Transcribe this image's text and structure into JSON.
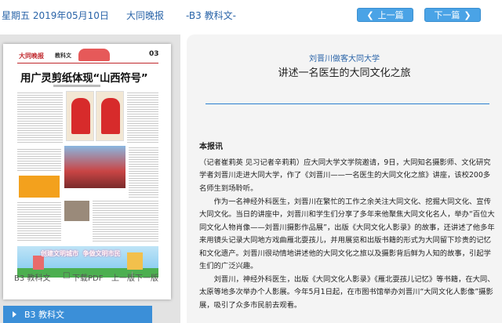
{
  "topbar": {
    "date": "星期五 2019年05月10日",
    "paper": "大同晚报",
    "page": "-B3 教科文-",
    "prev": "上一篇",
    "next": "下一篇"
  },
  "thumbnail": {
    "masthead": "大同晚报",
    "section": "教科文",
    "page_no": "03",
    "headline": "用广灵剪纸体现“山西符号”",
    "banner": "创建文明城市  争做文明市民"
  },
  "left": {
    "page_label": "B3 教科文",
    "download": "下载PDF",
    "prev_page": "上一版",
    "next_page": "下一版",
    "section_item": "B3  教科文"
  },
  "article": {
    "subtitle": "刘晋川做客大同大学",
    "title": "讲述一名医生的大同文化之旅",
    "byline": "本报讯",
    "paragraphs": [
      "（记者崔莉英 见习记者辛莉莉）应大同大学文学院邀请，9日，大同知名摄影师、文化研究学者刘晋川走进大同大学，作了《刘晋川——一名医生的大同文化之旅》讲座，该校200多名师生到场聆听。",
      "作为一名神经外科医生，刘晋川在繁忙的工作之余关注大同文化、挖掘大同文化、宣传大同文化。当日的讲座中，刘晋川和学生们分享了多年来他聚焦大同文化名人，举办“百位大同文化人物肖像——刘晋川摄影作品展”，出版《大同文化人影录》的故事，还讲述了他多年来用镜头记录大同地方戏曲雁北耍孩儿，并用展览和出版书籍的形式为大同留下珍贵的记忆和文化遗产。刘晋川很动情地讲述他的大同文化之旅以及摄影背后鲜为人知的故事，引起学生们的广泛兴趣。",
      "刘晋川，神经外科医生，出版《大同文化人影录》《雁北耍孩儿记忆》等书籍，在大同、太原等地多次举办个人影展。今年5月1日起，在市图书馆举办刘晋川“大同文化人影像”摄影展，吸引了众多市民前去观看。"
    ]
  },
  "colors": {
    "accent": "#3b8fd8",
    "link": "#2a64a8",
    "article_bg": "#f4f4f4",
    "panel_bg": "#e3e3e3"
  }
}
